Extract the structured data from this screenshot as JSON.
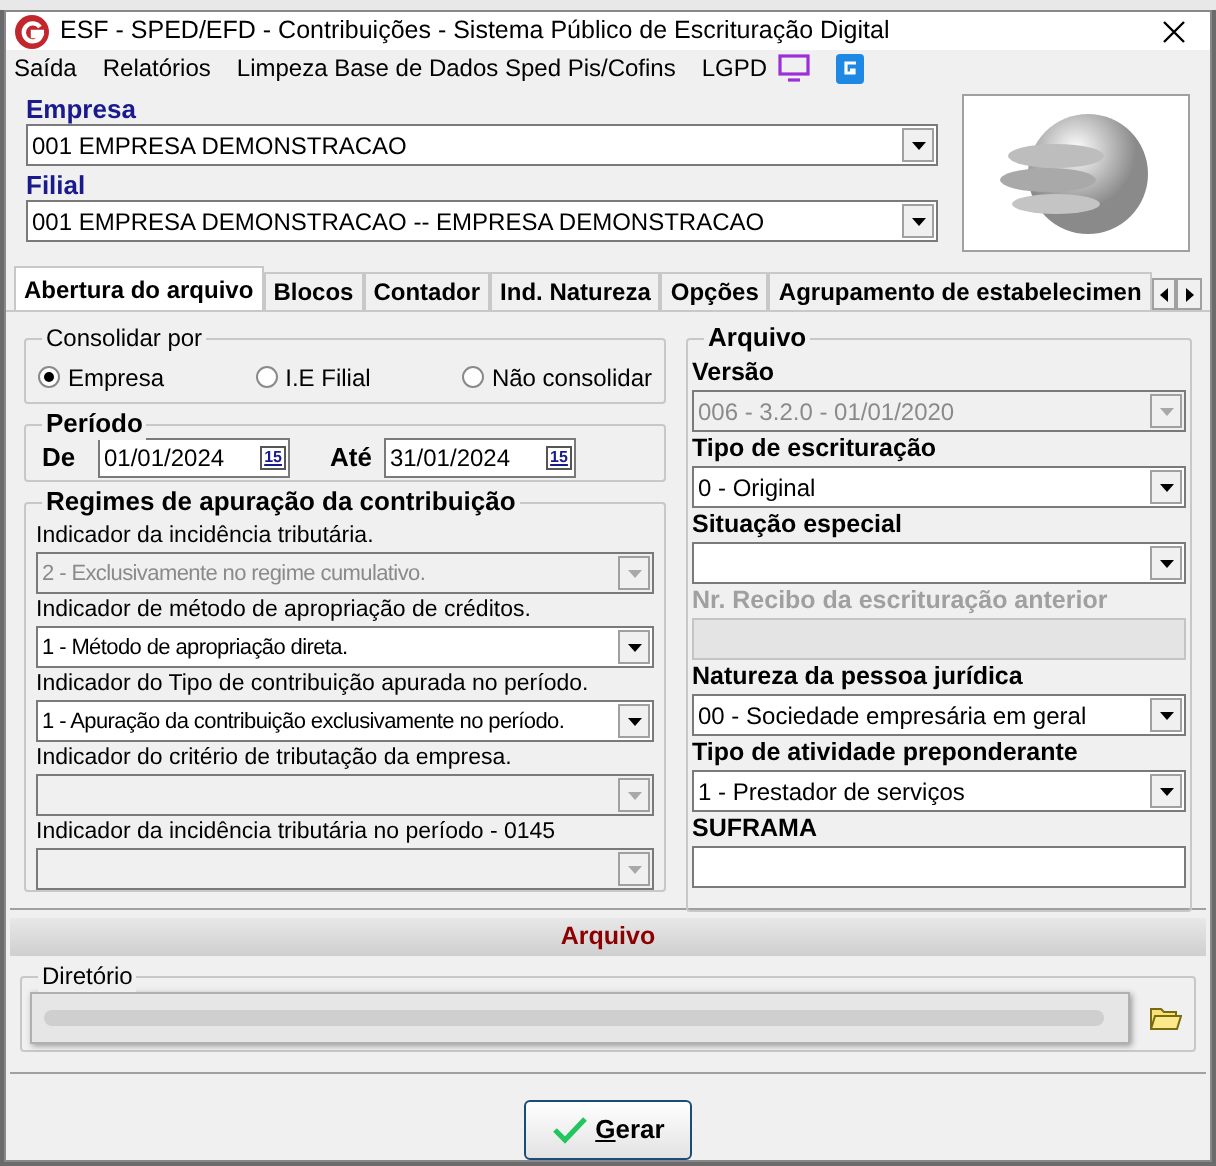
{
  "window": {
    "title": "ESF - SPED/EFD - Contribuições - Sistema Público de Escrituração Digital"
  },
  "menu": [
    "Saída",
    "Relatórios",
    "Limpeza Base de Dados Sped Pis/Cofins",
    "LGPD"
  ],
  "empresa": {
    "label": "Empresa",
    "value": "001 EMPRESA DEMONSTRACAO"
  },
  "filial": {
    "label": "Filial",
    "value": "001 EMPRESA DEMONSTRACAO -- EMPRESA DEMONSTRACAO"
  },
  "tabs": [
    {
      "label": "Abertura do arquivo",
      "selected": true
    },
    {
      "label": "Blocos",
      "selected": false
    },
    {
      "label": "Contador",
      "selected": false
    },
    {
      "label": "Ind. Natureza",
      "selected": false
    },
    {
      "label": "Opções",
      "selected": false
    },
    {
      "label": "Agrupamento de estabelecimen",
      "selected": false
    }
  ],
  "consolidar": {
    "title": "Consolidar por",
    "options": [
      {
        "label": "Empresa",
        "selected": true
      },
      {
        "label": "I.E Filial",
        "selected": false
      },
      {
        "label": "Não consolidar",
        "selected": false
      }
    ]
  },
  "periodo": {
    "title": "Período",
    "from_label": "De",
    "from": "01/01/2024",
    "to_label": "Até",
    "to": "31/01/2024",
    "from_calendar": "15",
    "to_calendar": "15"
  },
  "regimes": {
    "title": "Regimes de apuração da contribuição",
    "fields": [
      {
        "label": "Indicador da incidência tributária.",
        "value": "2 - Exclusivamente no regime cumulativo.",
        "disabled": true
      },
      {
        "label": "Indicador de método de apropriação de créditos.",
        "value": "1 - Método de apropriação direta.",
        "disabled": false
      },
      {
        "label": "Indicador do Tipo de contribuição apurada no período.",
        "value": "1 - Apuração da contribuição exclusivamente no período.",
        "disabled": false
      },
      {
        "label": "Indicador do critério de tributação da empresa.",
        "disabled": true
      },
      {
        "label": "Indicador da incidência tributária no período  - 0145",
        "disabled": true
      }
    ]
  },
  "arquivo_group": {
    "title": "Arquivo",
    "fields": [
      {
        "kind": "select",
        "label": "Versão",
        "value": "006 - 3.2.0 - 01/01/2020",
        "disabled": true
      },
      {
        "kind": "select",
        "label": "Tipo de escrituração",
        "value": "0 - Original",
        "disabled": false
      },
      {
        "kind": "select",
        "label": "Situação especial",
        "disabled": false
      },
      {
        "kind": "text",
        "label": "Nr. Recibo da escrituração anterior",
        "disabled": true
      },
      {
        "kind": "select",
        "label": "Natureza da pessoa jurídica",
        "value": "00 - Sociedade empresária em geral",
        "disabled": false
      },
      {
        "kind": "select",
        "label": "Tipo de atividade preponderante",
        "value": "1 - Prestador de serviços",
        "disabled": false
      },
      {
        "kind": "text",
        "label": "SUFRAMA",
        "disabled": false
      }
    ]
  },
  "arquivo_section": {
    "title": "Arquivo",
    "directory_label": "Diretório"
  },
  "buttons": [
    {
      "label": "Gerar"
    }
  ]
}
